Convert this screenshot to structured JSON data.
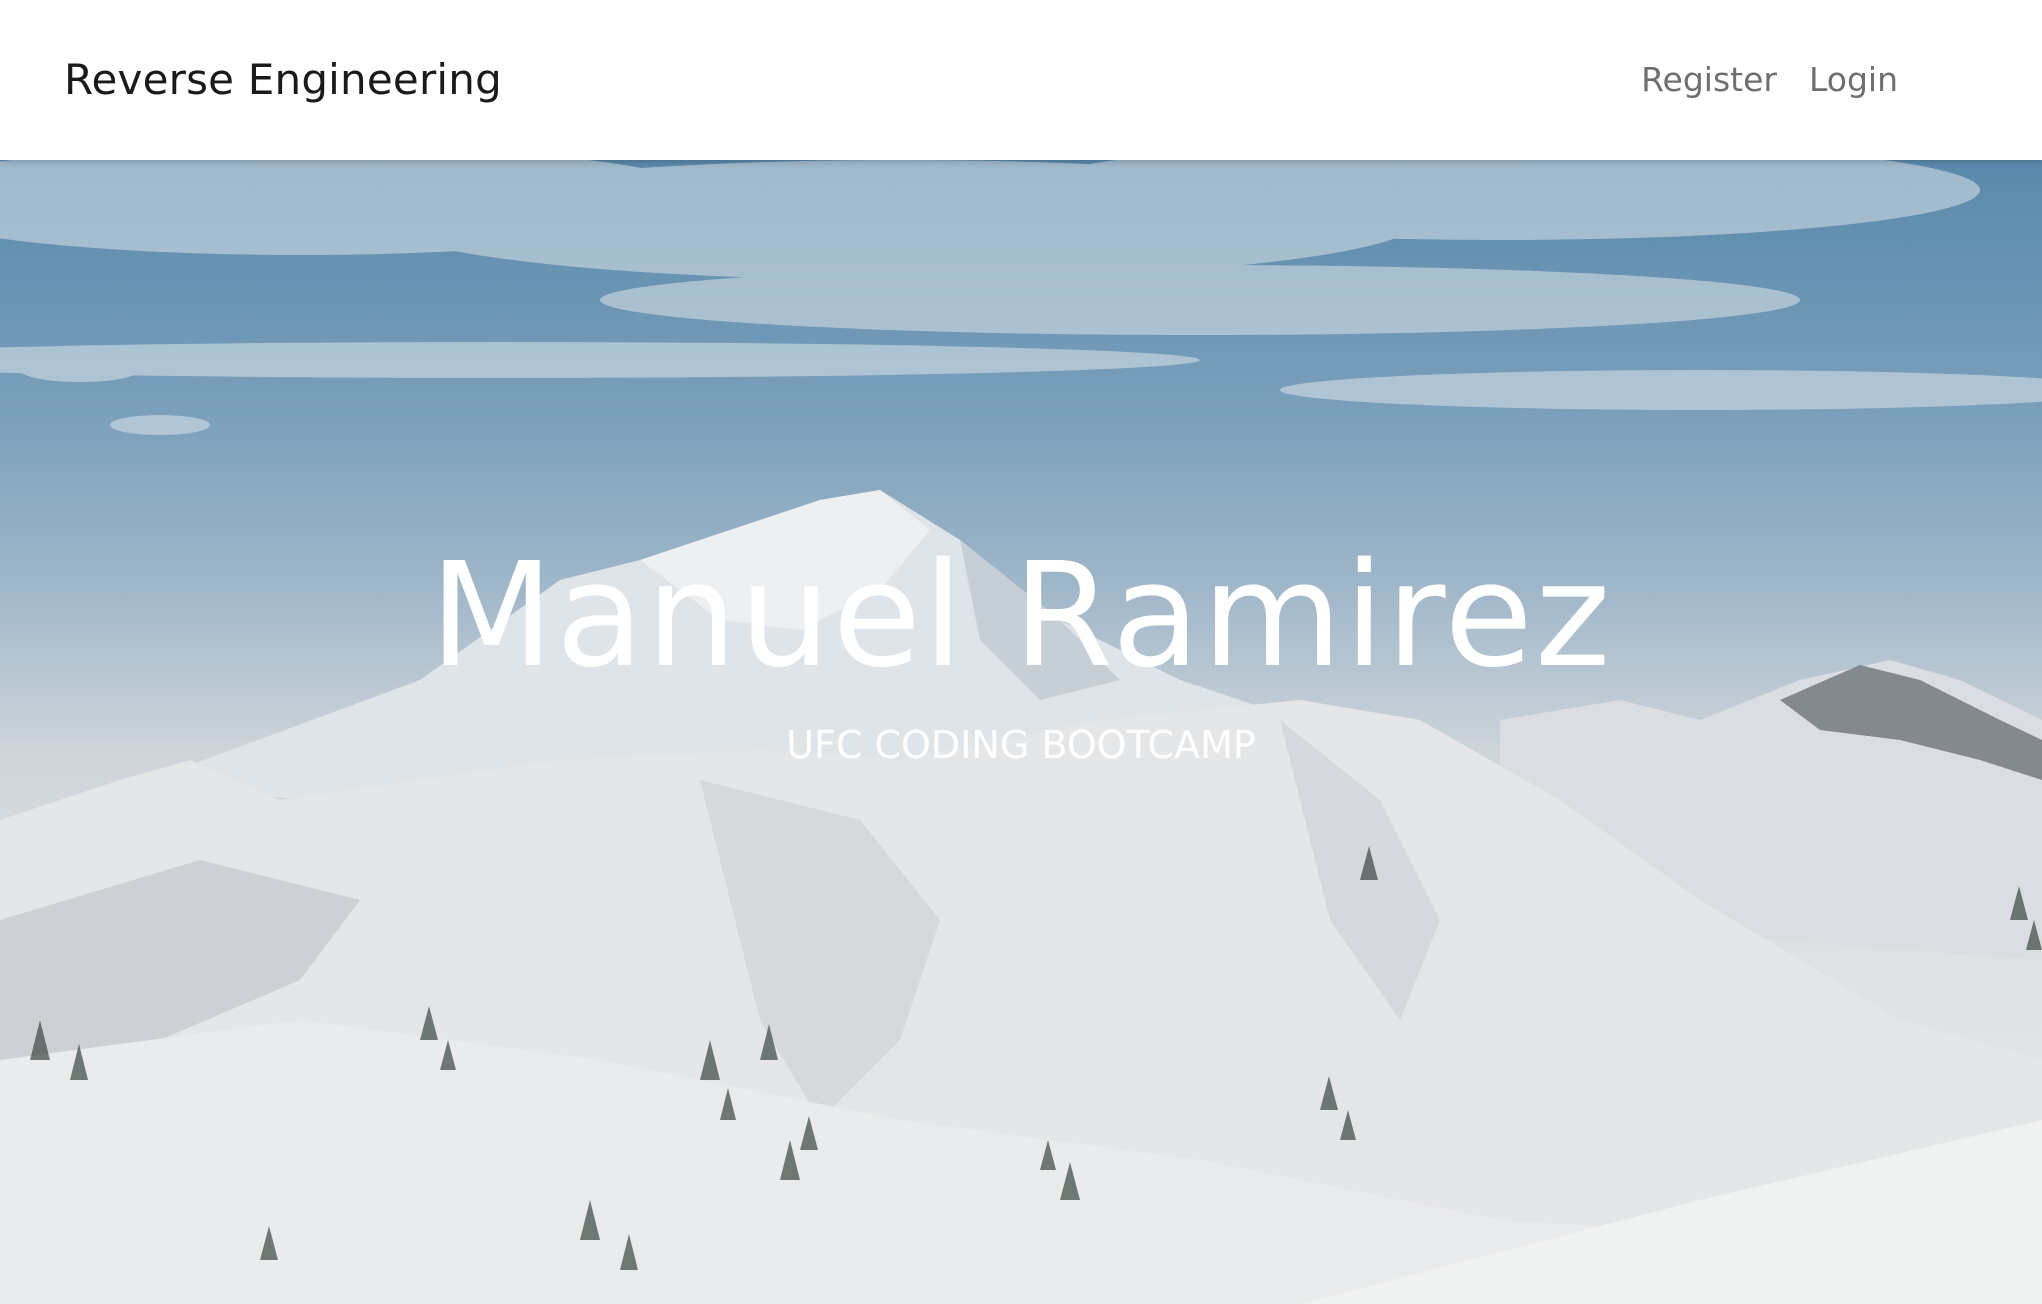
{
  "navbar": {
    "brand": "Reverse Engineering",
    "links": [
      {
        "label": "Register"
      },
      {
        "label": "Login"
      }
    ]
  },
  "hero": {
    "title": "Manuel Ramirez",
    "subtitle": "UFC CODING BOOTCAMP",
    "background": "snow-covered-mountain-landscape"
  },
  "colors": {
    "navbar_bg": "#ffffff",
    "brand_text": "#1a1a1a",
    "nav_link_text": "#6f6f6f",
    "hero_text": "#ffffff",
    "sky": "#6f9bbd"
  }
}
